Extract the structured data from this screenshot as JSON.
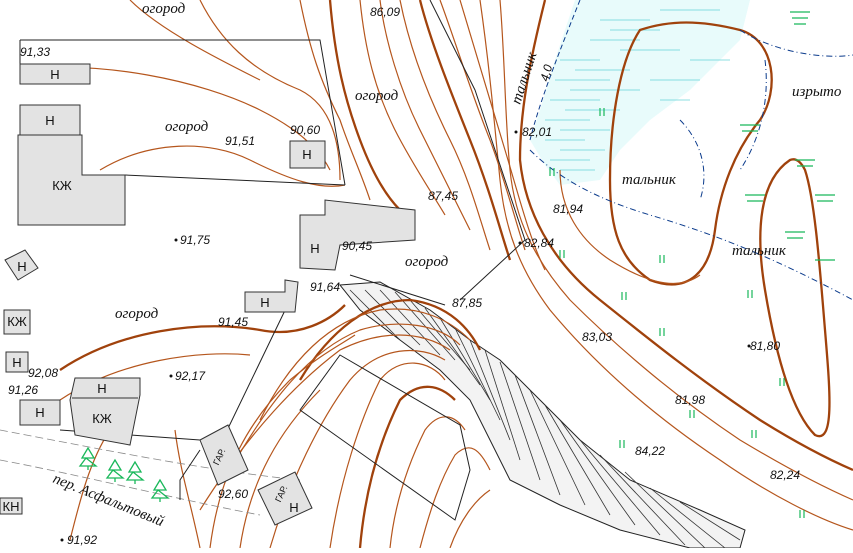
{
  "map": {
    "colors": {
      "contour": "#b5561d",
      "contour_index": "#a0420c",
      "vegetation": "#19b85a",
      "wetland_hatch": "#66d4d8",
      "building_fill": "#e3e3e3",
      "boundary": "#0b3b8c"
    },
    "places": {
      "ogorod_top": "огород",
      "ogorod_center": "огород",
      "ogorod_left": "огород",
      "ogorod_mid": "огород",
      "ogorod_lower": "огород",
      "talnik_vertical": "тальник",
      "talnik_1": "тальник",
      "talnik_2": "тальник",
      "izryto": "изрыто",
      "street": "пер. Асфальтовый"
    },
    "elevations": {
      "e1": "86,09",
      "e2": "91,33",
      "e3": "91,51",
      "e4": "90,60",
      "e5": "82,01",
      "e6": "87,45",
      "e7": "81,94",
      "e8": "91,75",
      "e9": "90,45",
      "e10": "82,84",
      "e11": "91,64",
      "e12": "87,85",
      "e13": "91,45",
      "e14": "83,03",
      "e15": "81,80",
      "e16": "92,17",
      "e17": "92,08",
      "e18": "91,26",
      "e19": "81,98",
      "e20": "84,22",
      "e21": "82,24",
      "e22": "92,60",
      "e23": "91,92",
      "e24": "4,0"
    },
    "buildings": {
      "n": "Н",
      "kzh": "КЖ",
      "gar": "ГАР.",
      "kn": "КН"
    }
  }
}
